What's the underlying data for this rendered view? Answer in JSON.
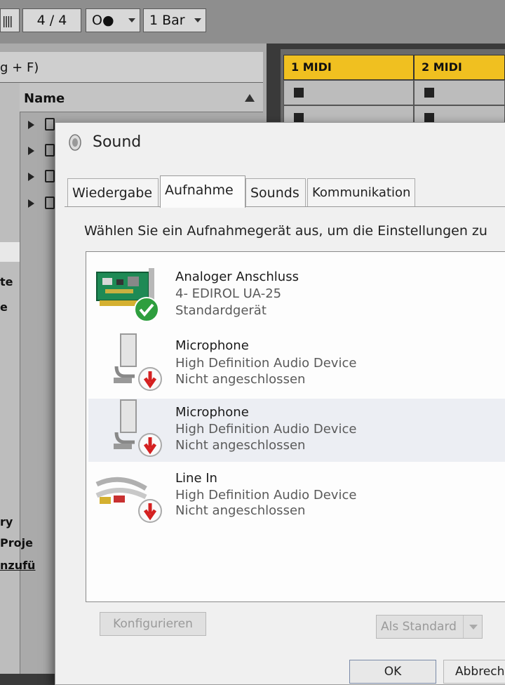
{
  "ableton": {
    "toolbar": {
      "metronome_glyph": "||||",
      "time_signature": "4 / 4",
      "record_mode": "O●",
      "quantize": "1 Bar"
    },
    "browser": {
      "search_hint": "g + F)",
      "name_header": "Name",
      "side_labels": [
        "te",
        "e",
        "ry",
        "Proje",
        "nzufü"
      ]
    },
    "tracks": [
      {
        "name": "1 MIDI",
        "color": "#f0c020"
      },
      {
        "name": "2 MIDI",
        "color": "#f0c020"
      }
    ]
  },
  "dialog": {
    "title": "Sound",
    "tabs": [
      {
        "label": "Wiedergabe",
        "active": false
      },
      {
        "label": "Aufnahme",
        "active": true
      },
      {
        "label": "Sounds",
        "active": false
      },
      {
        "label": "Kommunikation",
        "active": false
      }
    ],
    "instruction": "Wählen Sie ein Aufnahmegerät aus, um die Einstellungen zu",
    "devices": [
      {
        "name": "Analoger Anschluss",
        "device": "4- EDIROL UA-25",
        "status": "Standardgerät",
        "icon": "sound-card-icon",
        "badge": "default-check-icon"
      },
      {
        "name": "Microphone",
        "device": "High Definition Audio Device",
        "status": "Nicht angeschlossen",
        "icon": "microphone-icon",
        "badge": "unplugged-arrow-icon"
      },
      {
        "name": "Microphone",
        "device": "High Definition Audio Device",
        "status": "Nicht angeschlossen",
        "icon": "microphone-icon",
        "badge": "unplugged-arrow-icon"
      },
      {
        "name": "Line In",
        "device": "High Definition Audio Device",
        "status": "Nicht angeschlossen",
        "icon": "line-in-cable-icon",
        "badge": "unplugged-arrow-icon"
      }
    ],
    "buttons": {
      "configure": "Konfigurieren",
      "set_default": "Als Standard",
      "ok": "OK",
      "cancel": "Abbrech"
    }
  }
}
